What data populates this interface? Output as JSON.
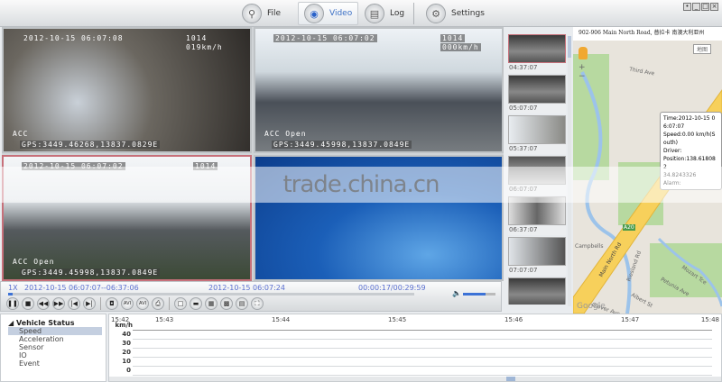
{
  "toolbar": {
    "tabs": [
      {
        "label": "File",
        "icon": "search-icon"
      },
      {
        "label": "Video",
        "icon": "video-icon",
        "active": true
      },
      {
        "label": "Log",
        "icon": "log-icon"
      },
      {
        "label": "Settings",
        "icon": "settings-icon"
      }
    ]
  },
  "video": {
    "channels": [
      {
        "datetime": "2012-10-15 06:07:08",
        "id": "1014",
        "speed": "019km/h",
        "acc": "ACC",
        "gps": "GPS:3449.46268,13837.0829E"
      },
      {
        "datetime": "2012-10-15 06:07:02",
        "id": "1014",
        "speed": "000km/h",
        "acc": "ACC Open",
        "gps": "GPS:3449.45998,13837.0849E"
      },
      {
        "datetime": "2012-10-15 06:07:02",
        "id": "1014",
        "speed": "",
        "acc": "ACC Open",
        "gps": "GPS:3449.45998,13837.0849E"
      },
      {
        "datetime": "",
        "id": "",
        "speed": "",
        "acc": "",
        "gps": ""
      }
    ]
  },
  "thumbnails": [
    "04:37:07",
    "05:07:07",
    "05:37:07",
    "06:07:07",
    "06:37:07",
    "07:07:07"
  ],
  "map": {
    "address": "902-906 Main North Road, 普拉卡 南澳大利亚州",
    "map_type": "地图",
    "labels": [
      "Third Ave",
      "Main North Rd",
      "Campbells",
      "Riesland Rd",
      "Albert St",
      "Petunia Ave",
      "Glover Ave",
      "Mozart Tce",
      "Google",
      "A20"
    ],
    "popup": {
      "time": "Time:2012-10-15 06:07:07",
      "speed": "Speed:0.00 km/h(South)",
      "driver": "Driver:",
      "position": "Position:138.618082",
      "position2": "34.8243326",
      "alarm": "Alarm:"
    }
  },
  "playback": {
    "rate": "1X",
    "range": "2012-10-15 06:07:07--06:37:06",
    "current": "2012-10-15 06:07:24",
    "elapsed": "00:00:17/00:29:59",
    "progress_percent": 1,
    "volume_percent": 70,
    "buttons": [
      [
        "pause",
        "❚❚"
      ],
      [
        "stop",
        "■"
      ],
      [
        "rewind",
        "◀◀"
      ],
      [
        "fast-forward",
        "▶▶"
      ],
      [
        "previous",
        "|◀"
      ],
      [
        "next",
        "▶|"
      ],
      [
        "snapshot",
        "◘"
      ],
      [
        "avi",
        "AVI"
      ],
      [
        "avi-export",
        "AVI"
      ],
      [
        "print",
        "⎙"
      ],
      [
        "layout-1",
        "□"
      ],
      [
        "layout-2",
        "▬"
      ],
      [
        "layout-4",
        "▦"
      ],
      [
        "layout-9",
        "▩"
      ],
      [
        "layout-16",
        "▤"
      ],
      [
        "fullscreen",
        "⛶"
      ]
    ]
  },
  "tree": {
    "root": "Vehicle Status",
    "items": [
      "Speed",
      "Acceleration",
      "Sensor",
      "IO",
      "Event"
    ],
    "selected": "Speed"
  },
  "chart": {
    "unit": "km/h",
    "times": [
      "15:42",
      "15:43",
      "15:44",
      "15:45",
      "15:46",
      "15:47",
      "15:48"
    ],
    "yticks": [
      "40",
      "30",
      "20",
      "10",
      "0"
    ]
  },
  "watermark": "trade.china.cn"
}
